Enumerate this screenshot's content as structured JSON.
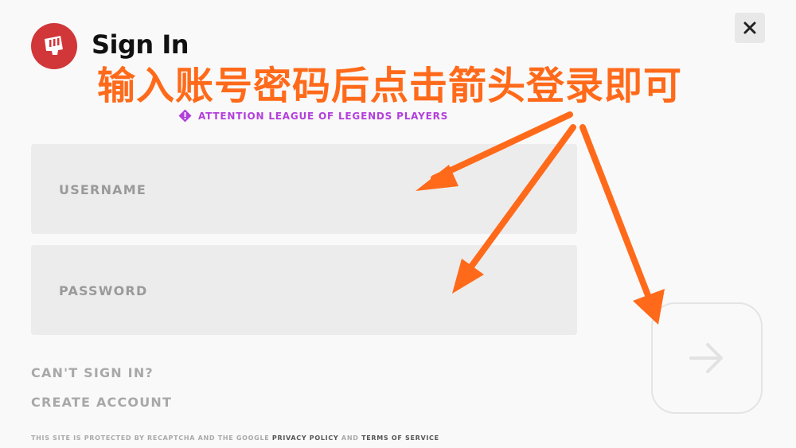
{
  "header": {
    "logo_icon": "riot-fist-icon",
    "title": "Sign In",
    "close_icon": "close-icon"
  },
  "annotation": {
    "text": "输入账号密码后点击箭头登录即可",
    "color": "#ff6a1a",
    "arrow_color": "#ff6a1a"
  },
  "notice": {
    "icon": "alert-diamond-icon",
    "text": "ATTENTION LEAGUE OF LEGENDS PLAYERS",
    "color": "#b23fdb"
  },
  "form": {
    "username_placeholder": "USERNAME",
    "password_placeholder": "PASSWORD",
    "submit_icon": "arrow-right-icon"
  },
  "links": {
    "cant_sign_in": "CAN'T SIGN IN?",
    "create_account": "CREATE ACCOUNT"
  },
  "footer": {
    "prefix": "THIS SITE IS PROTECTED BY RECAPTCHA AND THE GOOGLE",
    "privacy_policy": "PRIVACY POLICY",
    "and": "AND",
    "terms_of_service": "TERMS OF SERVICE"
  },
  "colors": {
    "brand_red": "#d13639",
    "background": "#f9f9f9",
    "field_bg": "#ececec"
  }
}
